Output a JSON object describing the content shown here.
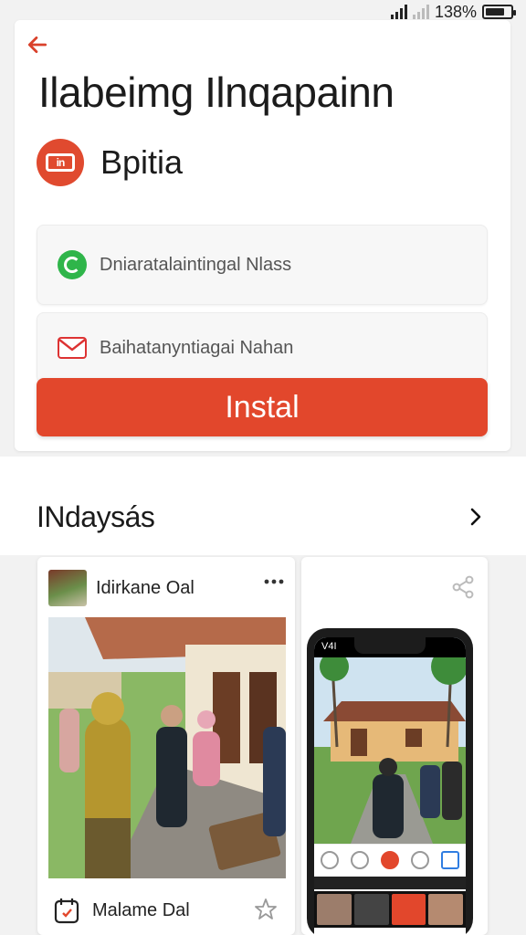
{
  "status": {
    "battery_text": "138%",
    "battery_level": 0.75
  },
  "app": {
    "title": "Ilabeimg Ilnqapainn",
    "developer": "Bpitia",
    "field_primary": "Dniaratalaintingal Nlass",
    "field_secondary": "Baihatanyntiagai Nahan",
    "install_label": "Instal"
  },
  "section": {
    "title": "INdaysás"
  },
  "cards": {
    "left": {
      "name": "Idirkane Oal",
      "footer_name": "Malame Dal"
    },
    "right": {
      "phone_status": "V4I"
    }
  },
  "colors": {
    "accent": "#e2472c",
    "check_green": "#2fb54a",
    "background": "#f2f2f2"
  },
  "icons": {
    "back": "back-arrow-icon",
    "dev_logo": "developer-logo-icon",
    "check": "check-icon",
    "mail": "mail-icon",
    "chevron": "chevron-right-icon",
    "more": "more-icon",
    "share": "share-icon",
    "calendar": "calendar-icon",
    "star": "star-icon"
  }
}
